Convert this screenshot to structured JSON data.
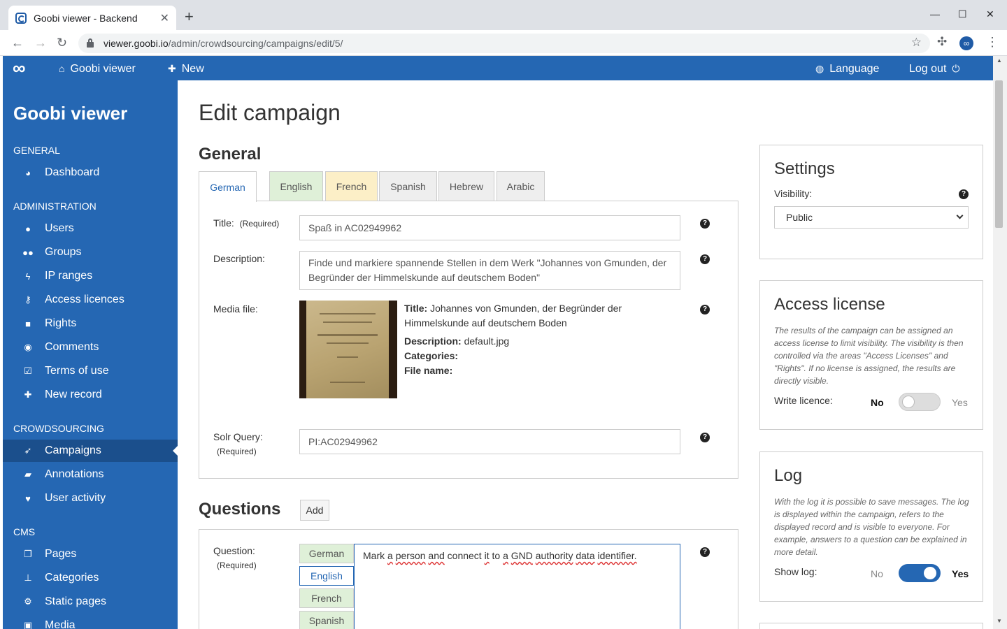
{
  "browser": {
    "tab_title": "Goobi viewer - Backend",
    "url_host": "viewer.goobi.io",
    "url_path": "/admin/crowdsourcing/campaigns/edit/5/"
  },
  "topnav": {
    "logo": "∞",
    "home_label": "Goobi viewer",
    "new_label": "New",
    "language_label": "Language",
    "logout_label": "Log out"
  },
  "sidebar": {
    "title": "Goobi viewer",
    "sections": [
      {
        "heading": "GENERAL",
        "items": [
          {
            "label": "Dashboard",
            "icon": "dashboard-icon"
          }
        ]
      },
      {
        "heading": "ADMINISTRATION",
        "items": [
          {
            "label": "Users",
            "icon": "user-icon"
          },
          {
            "label": "Groups",
            "icon": "users-icon"
          },
          {
            "label": "IP ranges",
            "icon": "bolt-icon"
          },
          {
            "label": "Access licences",
            "icon": "key-icon"
          },
          {
            "label": "Rights",
            "icon": "lock-icon"
          },
          {
            "label": "Comments",
            "icon": "comments-icon"
          },
          {
            "label": "Terms of use",
            "icon": "check-square-icon"
          },
          {
            "label": "New record",
            "icon": "plus-icon"
          }
        ]
      },
      {
        "heading": "CROWDSOURCING",
        "items": [
          {
            "label": "Campaigns",
            "icon": "rocket-icon"
          },
          {
            "label": "Annotations",
            "icon": "note-icon"
          },
          {
            "label": "User activity",
            "icon": "heartbeat-icon"
          }
        ]
      },
      {
        "heading": "CMS",
        "items": [
          {
            "label": "Pages",
            "icon": "copy-icon"
          },
          {
            "label": "Categories",
            "icon": "pin-icon"
          },
          {
            "label": "Static pages",
            "icon": "cogs-icon"
          },
          {
            "label": "Media",
            "icon": "image-icon"
          }
        ]
      }
    ]
  },
  "main": {
    "page_title": "Edit campaign",
    "general_title": "General",
    "lang_tabs": [
      "German",
      "English",
      "French",
      "Spanish",
      "Hebrew",
      "Arabic"
    ],
    "fields": {
      "title_label": "Title:",
      "title_required": "(Required)",
      "title_value": "Spaß in AC02949962",
      "description_label": "Description:",
      "description_value": "Finde und markiere spannende Stellen in dem Werk \"Johannes von Gmunden, der Begründer der Himmelskunde auf deutschem Boden\"",
      "media_label": "Media file:",
      "media_title_key": "Title:",
      "media_title_value": "Johannes von Gmunden, der Begründer der Himmelskunde auf deutschem Boden",
      "media_desc_key": "Description:",
      "media_desc_value": "default.jpg",
      "media_categories_key": "Categories:",
      "media_filename_key": "File name:",
      "solr_label": "Solr Query:",
      "solr_required": "(Required)",
      "solr_value": "PI:AC02949962"
    },
    "questions_title": "Questions",
    "add_label": "Add",
    "question": {
      "label": "Question:",
      "required": "(Required)",
      "langs": [
        "German",
        "English",
        "French",
        "Spanish"
      ],
      "words": [
        "Mark",
        "a",
        "person",
        "and",
        "connect",
        "it",
        "to",
        "a",
        "GND",
        "authority",
        "data",
        "identifier."
      ]
    },
    "help_glyph": "?"
  },
  "settings": {
    "title": "Settings",
    "visibility_label": "Visibility:",
    "visibility_value": "Public"
  },
  "access_license": {
    "title": "Access license",
    "description": "The results of the campaign can be assigned an access license to limit visibility. The visibility is then controlled via the areas \"Access Licenses\" and \"Rights\". If no license is assigned, the results are directly visible.",
    "write_label": "Write licence:",
    "no": "No",
    "yes": "Yes",
    "enabled": false
  },
  "log": {
    "title": "Log",
    "description": "With the log it is possible to save messages. The log is displayed within the campaign, refers to the displayed record and is visible to everyone. For example, answers to a question can be explained in more detail.",
    "show_label": "Show log:",
    "no": "No",
    "yes": "Yes",
    "enabled": true
  },
  "colors": {
    "primary": "#2567b3",
    "sidebar_active": "#1b4f8c",
    "tab_green": "#dff0d8",
    "tab_yellow": "#fcefc7"
  }
}
